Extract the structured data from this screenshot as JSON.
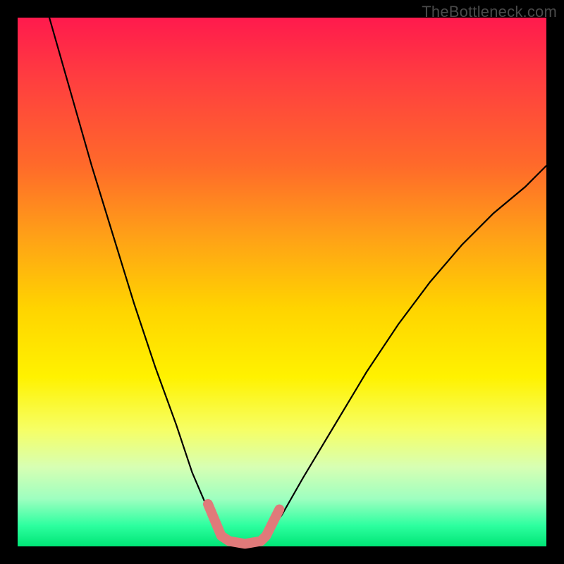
{
  "watermark": {
    "text": "TheBottleneck.com"
  },
  "chart_data": {
    "type": "line",
    "title": "",
    "xlabel": "",
    "ylabel": "",
    "xlim": [
      0,
      100
    ],
    "ylim": [
      0,
      100
    ],
    "grid": false,
    "legend": false,
    "background": "rainbow-vertical-gradient",
    "series": [
      {
        "name": "left-curve",
        "stroke": "#000000",
        "x": [
          6,
          10,
          14,
          18,
          22,
          26,
          30,
          33,
          36,
          38.5
        ],
        "y": [
          100,
          86,
          72,
          59,
          46,
          34,
          23,
          14,
          7,
          2
        ]
      },
      {
        "name": "right-curve",
        "stroke": "#000000",
        "x": [
          47,
          50,
          54,
          60,
          66,
          72,
          78,
          84,
          90,
          96,
          100
        ],
        "y": [
          2,
          6,
          13,
          23,
          33,
          42,
          50,
          57,
          63,
          68,
          72
        ]
      },
      {
        "name": "salmon-overlay",
        "stroke": "#e07a7a",
        "thick": true,
        "x": [
          36,
          38.5,
          40,
          43,
          46,
          47,
          49.5
        ],
        "y": [
          8,
          2,
          1,
          0.5,
          1,
          2,
          7
        ]
      }
    ]
  }
}
